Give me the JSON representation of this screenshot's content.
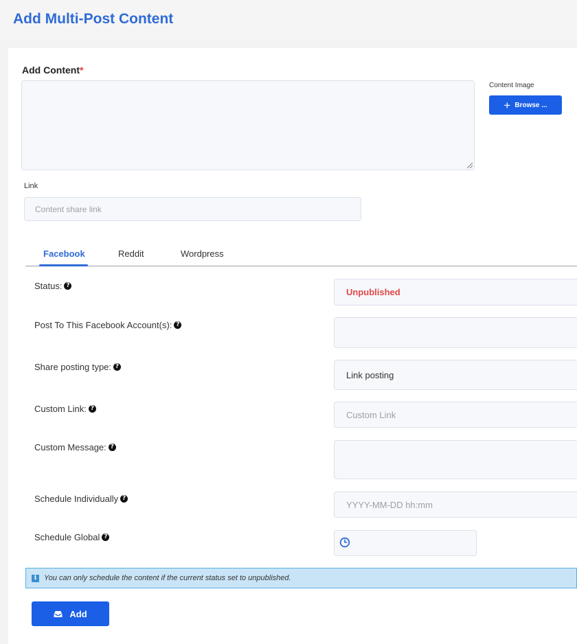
{
  "page": {
    "title": "Add Multi-Post Content"
  },
  "content": {
    "label": "Add Content",
    "required_mark": "*",
    "image_label": "Content Image",
    "browse_label": "Browse ..."
  },
  "link": {
    "label": "Link",
    "placeholder": "Content share link"
  },
  "tabs": [
    {
      "label": "Facebook",
      "active": true
    },
    {
      "label": "Reddit",
      "active": false
    },
    {
      "label": "Wordpress",
      "active": false
    }
  ],
  "facebook": {
    "status": {
      "label": "Status:",
      "value": "Unpublished"
    },
    "accounts": {
      "label": "Post To This Facebook Account(s):",
      "value": ""
    },
    "share_type": {
      "label": "Share posting type:",
      "value": "Link posting"
    },
    "custom_link": {
      "label": "Custom Link:",
      "placeholder": "Custom Link"
    },
    "custom_message": {
      "label": "Custom Message:",
      "value": ""
    },
    "schedule_individually": {
      "label": "Schedule Individually",
      "placeholder": "YYYY-MM-DD hh:mm"
    },
    "schedule_global": {
      "label": "Schedule Global",
      "value": ""
    }
  },
  "info": {
    "icon": "info-icon",
    "message": "You can only schedule the content if the current status set to unpublished."
  },
  "actions": {
    "add_label": "Add"
  },
  "colors": {
    "accent": "#2f6bd6",
    "button": "#1a5fe6",
    "status_unpublished": "#e04848",
    "info_bg": "#c9e4f7"
  },
  "icons": {
    "help": "question-circle-icon",
    "browse": "plus-icon",
    "clock": "clock-icon",
    "add": "inbox-icon"
  }
}
